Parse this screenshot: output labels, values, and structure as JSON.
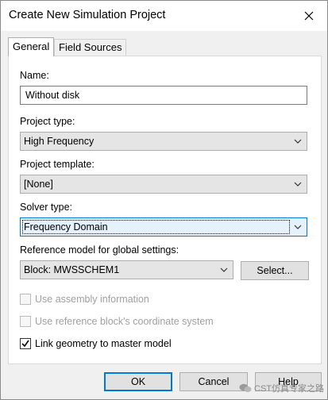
{
  "window": {
    "title": "Create New Simulation Project"
  },
  "tabs": [
    {
      "label": "General",
      "active": true
    },
    {
      "label": "Field Sources",
      "active": false
    }
  ],
  "form": {
    "name_label": "Name:",
    "name_value": "Without disk",
    "project_type_label": "Project type:",
    "project_type_value": "High Frequency",
    "project_template_label": "Project template:",
    "project_template_value": "[None]",
    "solver_type_label": "Solver type:",
    "solver_type_value": "Frequency Domain",
    "reference_model_label": "Reference model for global settings:",
    "reference_model_value": "Block: MWSSCHEM1",
    "select_button": "Select...",
    "use_assembly_label": "Use assembly information",
    "use_assembly_checked": false,
    "use_reference_label": "Use reference block's coordinate system",
    "use_reference_checked": false,
    "link_geometry_label": "Link geometry to master model",
    "link_geometry_checked": true
  },
  "footer": {
    "ok": "OK",
    "cancel": "Cancel",
    "help": "Help"
  },
  "watermark": {
    "text": "CST仿真专家之路",
    "icon": "wechat-icon"
  },
  "colors": {
    "accent": "#0078d7",
    "disabled_text": "#a0a0a0"
  }
}
